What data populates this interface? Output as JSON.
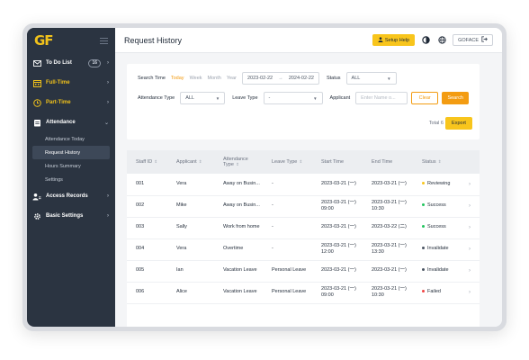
{
  "app": {
    "logo": "GF"
  },
  "sidebar": {
    "items": [
      {
        "label": "To Do List",
        "badge": "16",
        "icon": "mail-icon"
      },
      {
        "label": "Full-Time",
        "icon": "calendar-icon",
        "color": "#f1c21b"
      },
      {
        "label": "Part-Time",
        "icon": "clock-icon",
        "color": "#f1c21b"
      },
      {
        "label": "Attendance",
        "icon": "clipboard-icon"
      },
      {
        "label": "Access Records",
        "icon": "users-icon"
      },
      {
        "label": "Basic Settings",
        "icon": "gear-icon"
      }
    ],
    "attendance_sub": [
      "Attendance Today",
      "Request History",
      "Hours Summary",
      "Settings"
    ]
  },
  "header": {
    "title": "Request History",
    "help_label": "Setup Help",
    "user_label": "GOFACE"
  },
  "filters": {
    "search_time_label": "Search Time",
    "time_options": [
      "Today",
      "Week",
      "Month",
      "Year"
    ],
    "date_start": "2023-02-22",
    "date_sep": "→",
    "date_end": "2024-02-22",
    "status_label": "Status",
    "status_value": "ALL",
    "attendance_type_label": "Attendance Type",
    "attendance_type_value": "ALL",
    "leave_type_label": "Leave Type",
    "leave_type_value": "-",
    "applicant_label": "Applicant",
    "applicant_placeholder": "Enter Name o...",
    "clear_label": "Clear",
    "search_label": "Search",
    "total_label": "Total 6",
    "export_label": "Export"
  },
  "table": {
    "headers": [
      "Staff ID",
      "Applicant",
      "Attendance Type",
      "Leave Type",
      "Start Time",
      "End Time",
      "Status"
    ],
    "rows": [
      {
        "id": "001",
        "applicant": "Vera",
        "attendance": "Away on Busin...",
        "leave": "-",
        "start": "2023-03-21 (一)",
        "end": "2023-03-21 (一)",
        "status": "Reviewing",
        "status_color": "#f8c51c"
      },
      {
        "id": "002",
        "applicant": "Mike",
        "attendance": "Away on Busin...",
        "leave": "-",
        "start": "2023-03-21 (一) 09:00",
        "end": "2023-03-21 (一) 10:30",
        "status": "Success",
        "status_color": "#22c55e"
      },
      {
        "id": "003",
        "applicant": "Sally",
        "attendance": "Work from home",
        "leave": "-",
        "start": "2023-03-21 (一)",
        "end": "2023-03-22 (二)",
        "status": "Success",
        "status_color": "#22c55e"
      },
      {
        "id": "004",
        "applicant": "Vera",
        "attendance": "Overtime",
        "leave": "-",
        "start": "2023-03-21 (一) 12:00",
        "end": "2023-03-21 (一) 13:30",
        "status": "Invalidate",
        "status_color": "#4b5563"
      },
      {
        "id": "005",
        "applicant": "Ian",
        "attendance": "Vacation Leave",
        "leave": "Personal Leave",
        "start": "2023-03-21 (一)",
        "end": "2023-03-21 (一)",
        "status": "Invalidate",
        "status_color": "#4b5563"
      },
      {
        "id": "006",
        "applicant": "Alice",
        "attendance": "Vacation Leave",
        "leave": "Personal Leave",
        "start": "2023-03-21 (一) 09:00",
        "end": "2023-03-21 (一) 10:30",
        "status": "Failed",
        "status_color": "#ef4444"
      }
    ]
  }
}
